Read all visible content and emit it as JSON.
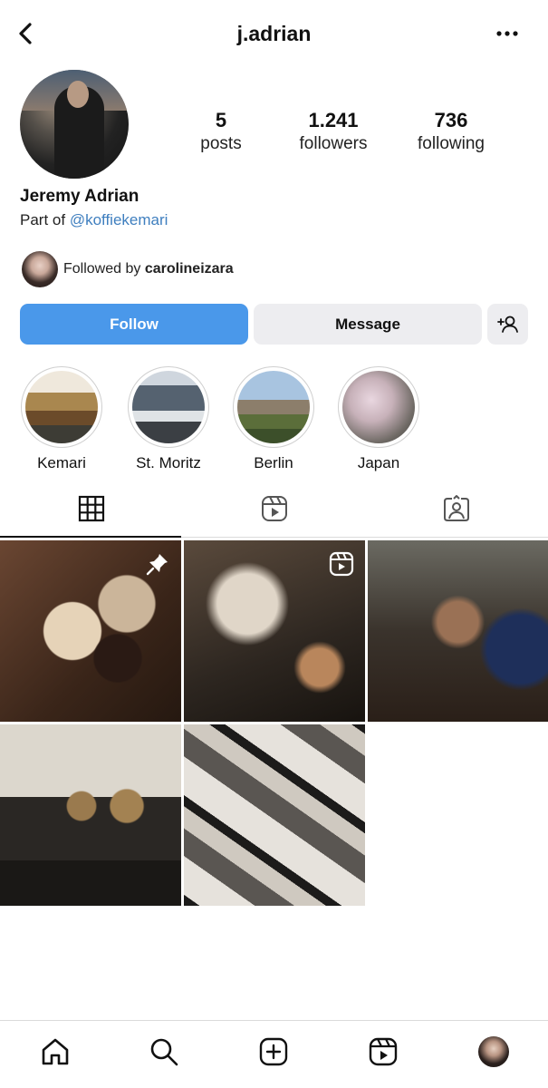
{
  "header": {
    "username": "j.adrian",
    "back_icon": "back-chevron-icon",
    "more_icon": "more-horizontal-icon"
  },
  "profile": {
    "stats": [
      {
        "value": "5",
        "label": "posts"
      },
      {
        "value": "1.241",
        "label": "followers"
      },
      {
        "value": "736",
        "label": "following"
      }
    ],
    "full_name": "Jeremy Adrian",
    "bio_prefix": "Part of",
    "bio_mention": "@koffiekemari",
    "followed_by_prefix": "Followed by",
    "followed_by_user": "carolineizara"
  },
  "actions": {
    "follow_label": "Follow",
    "message_label": "Message",
    "add_user_icon": "add-user-icon"
  },
  "highlights": [
    {
      "label": "Kemari"
    },
    {
      "label": "St. Moritz"
    },
    {
      "label": "Berlin"
    },
    {
      "label": "Japan"
    }
  ],
  "tabs": [
    {
      "icon": "grid-icon",
      "active": true
    },
    {
      "icon": "reels-icon",
      "active": false
    },
    {
      "icon": "tagged-icon",
      "active": false
    }
  ],
  "posts": [
    {
      "badge": "pin-icon"
    },
    {
      "badge": "reel-icon"
    },
    {
      "badge": ""
    },
    {
      "badge": ""
    },
    {
      "badge": ""
    }
  ],
  "bottom_nav": [
    "home-icon",
    "search-icon",
    "create-icon",
    "reels-icon",
    "profile-avatar"
  ],
  "colors": {
    "follow_button": "#4a98ea",
    "secondary_button": "#ededf0",
    "mention": "#3f7fbf"
  }
}
